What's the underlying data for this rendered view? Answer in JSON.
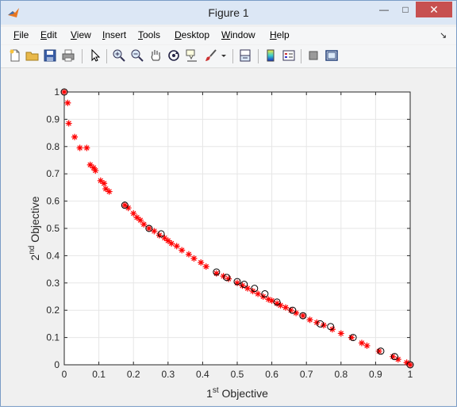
{
  "window": {
    "title": "Figure 1",
    "minimize_glyph": "—",
    "maximize_glyph": "□",
    "close_glyph": "✕"
  },
  "menubar": {
    "items": [
      {
        "label": "File",
        "access_key": "F",
        "rest": "ile"
      },
      {
        "label": "Edit",
        "access_key": "E",
        "rest": "dit"
      },
      {
        "label": "View",
        "access_key": "V",
        "rest": "iew"
      },
      {
        "label": "Insert",
        "access_key": "I",
        "rest": "nsert"
      },
      {
        "label": "Tools",
        "access_key": "T",
        "rest": "ools"
      },
      {
        "label": "Desktop",
        "access_key": "D",
        "rest": "esktop"
      },
      {
        "label": "Window",
        "access_key": "W",
        "rest": "indow"
      },
      {
        "label": "Help",
        "access_key": "H",
        "rest": "elp"
      }
    ],
    "dock_glyph": "↘"
  },
  "toolbar": {
    "icons": [
      "new-figure-icon",
      "open-file-icon",
      "save-icon",
      "print-icon",
      "edit-plot-arrow-icon",
      "zoom-in-icon",
      "zoom-out-icon",
      "pan-hand-icon",
      "rotate-3d-icon",
      "data-cursor-icon",
      "brush-icon",
      "brush-dropdown-icon",
      "link-plot-icon",
      "insert-colorbar-icon",
      "insert-legend-icon",
      "hide-plot-tools-icon",
      "show-plot-tools-icon"
    ]
  },
  "colors": {
    "titlebar": "#dce7f5",
    "close_button": "#c75050",
    "series_red": "#ff0000",
    "series_black": "#000000",
    "grid": "#e6e6e6"
  },
  "chart_data": {
    "type": "scatter",
    "xlabel_main": "1",
    "xlabel_sup": "st",
    "xlabel_rest": " Objective",
    "ylabel_main": "2",
    "ylabel_sup": "nd",
    "ylabel_rest": " Objective",
    "xlim": [
      0,
      1
    ],
    "ylim": [
      0,
      1
    ],
    "xticks": [
      "0",
      "0.1",
      "0.2",
      "0.3",
      "0.4",
      "0.5",
      "0.6",
      "0.7",
      "0.8",
      "0.9",
      "1"
    ],
    "yticks": [
      "0",
      "0.1",
      "0.2",
      "0.3",
      "0.4",
      "0.5",
      "0.6",
      "0.7",
      "0.8",
      "0.9",
      "1"
    ],
    "grid": true,
    "series": [
      {
        "marker": "asterisk",
        "color": "#ff0000",
        "points": [
          [
            0.0,
            1.0
          ],
          [
            0.01,
            0.96
          ],
          [
            0.013,
            0.885
          ],
          [
            0.03,
            0.835
          ],
          [
            0.045,
            0.795
          ],
          [
            0.065,
            0.795
          ],
          [
            0.075,
            0.733
          ],
          [
            0.085,
            0.722
          ],
          [
            0.09,
            0.712
          ],
          [
            0.105,
            0.675
          ],
          [
            0.115,
            0.665
          ],
          [
            0.12,
            0.645
          ],
          [
            0.13,
            0.635
          ],
          [
            0.175,
            0.585
          ],
          [
            0.185,
            0.575
          ],
          [
            0.2,
            0.555
          ],
          [
            0.21,
            0.54
          ],
          [
            0.22,
            0.53
          ],
          [
            0.23,
            0.515
          ],
          [
            0.245,
            0.5
          ],
          [
            0.26,
            0.49
          ],
          [
            0.275,
            0.475
          ],
          [
            0.29,
            0.465
          ],
          [
            0.3,
            0.455
          ],
          [
            0.31,
            0.445
          ],
          [
            0.325,
            0.435
          ],
          [
            0.34,
            0.42
          ],
          [
            0.36,
            0.405
          ],
          [
            0.375,
            0.39
          ],
          [
            0.395,
            0.375
          ],
          [
            0.41,
            0.36
          ],
          [
            0.44,
            0.335
          ],
          [
            0.46,
            0.325
          ],
          [
            0.475,
            0.315
          ],
          [
            0.5,
            0.3
          ],
          [
            0.515,
            0.29
          ],
          [
            0.53,
            0.28
          ],
          [
            0.545,
            0.27
          ],
          [
            0.56,
            0.26
          ],
          [
            0.575,
            0.25
          ],
          [
            0.59,
            0.24
          ],
          [
            0.6,
            0.235
          ],
          [
            0.615,
            0.225
          ],
          [
            0.625,
            0.218
          ],
          [
            0.64,
            0.21
          ],
          [
            0.655,
            0.2
          ],
          [
            0.67,
            0.19
          ],
          [
            0.69,
            0.18
          ],
          [
            0.71,
            0.165
          ],
          [
            0.73,
            0.155
          ],
          [
            0.75,
            0.145
          ],
          [
            0.775,
            0.13
          ],
          [
            0.8,
            0.115
          ],
          [
            0.83,
            0.1
          ],
          [
            0.86,
            0.08
          ],
          [
            0.875,
            0.07
          ],
          [
            0.91,
            0.05
          ],
          [
            0.95,
            0.03
          ],
          [
            0.965,
            0.02
          ],
          [
            0.99,
            0.008
          ],
          [
            1.0,
            0.0
          ]
        ]
      },
      {
        "marker": "circle",
        "color": "#000000",
        "points": [
          [
            0.0,
            1.0
          ],
          [
            0.175,
            0.585
          ],
          [
            0.245,
            0.5
          ],
          [
            0.28,
            0.48
          ],
          [
            0.44,
            0.34
          ],
          [
            0.47,
            0.32
          ],
          [
            0.5,
            0.305
          ],
          [
            0.52,
            0.295
          ],
          [
            0.55,
            0.28
          ],
          [
            0.58,
            0.26
          ],
          [
            0.615,
            0.23
          ],
          [
            0.66,
            0.2
          ],
          [
            0.69,
            0.18
          ],
          [
            0.74,
            0.15
          ],
          [
            0.77,
            0.14
          ],
          [
            0.835,
            0.1
          ],
          [
            0.915,
            0.05
          ],
          [
            0.955,
            0.03
          ],
          [
            1.0,
            0.0
          ]
        ]
      }
    ]
  }
}
